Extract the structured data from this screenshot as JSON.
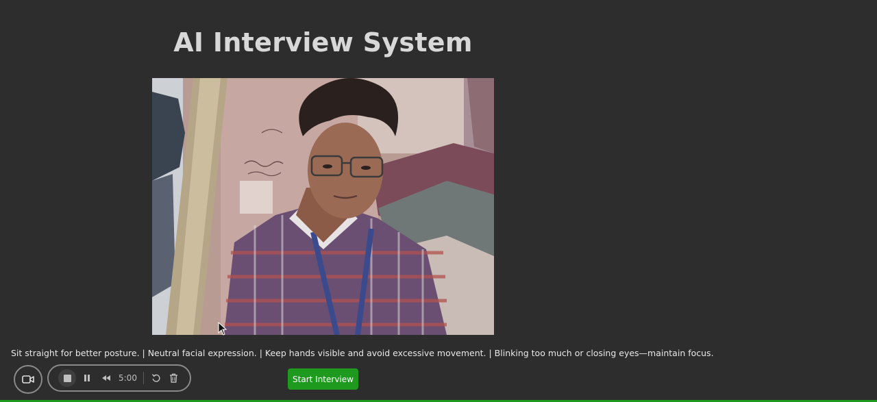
{
  "app": {
    "title": "AI Interview System"
  },
  "video": {
    "description_icon": "webcam-feed"
  },
  "tips": {
    "text": "Sit straight for better posture. | Neutral facial expression. | Keep hands visible and avoid excessive movement. | Blinking too much or closing eyes—maintain focus."
  },
  "recorder": {
    "camera_icon": "video-camera-icon",
    "stop_icon": "stop-icon",
    "pause_icon": "pause-icon",
    "rewind_icon": "rewind-icon",
    "time": "5:00",
    "restart_icon": "restart-icon",
    "delete_icon": "trash-icon"
  },
  "actions": {
    "start_label": "Start Interview"
  },
  "colors": {
    "background": "#2d2d2d",
    "accent_green": "#1e9b1e",
    "control_border": "#8a8a8a"
  }
}
